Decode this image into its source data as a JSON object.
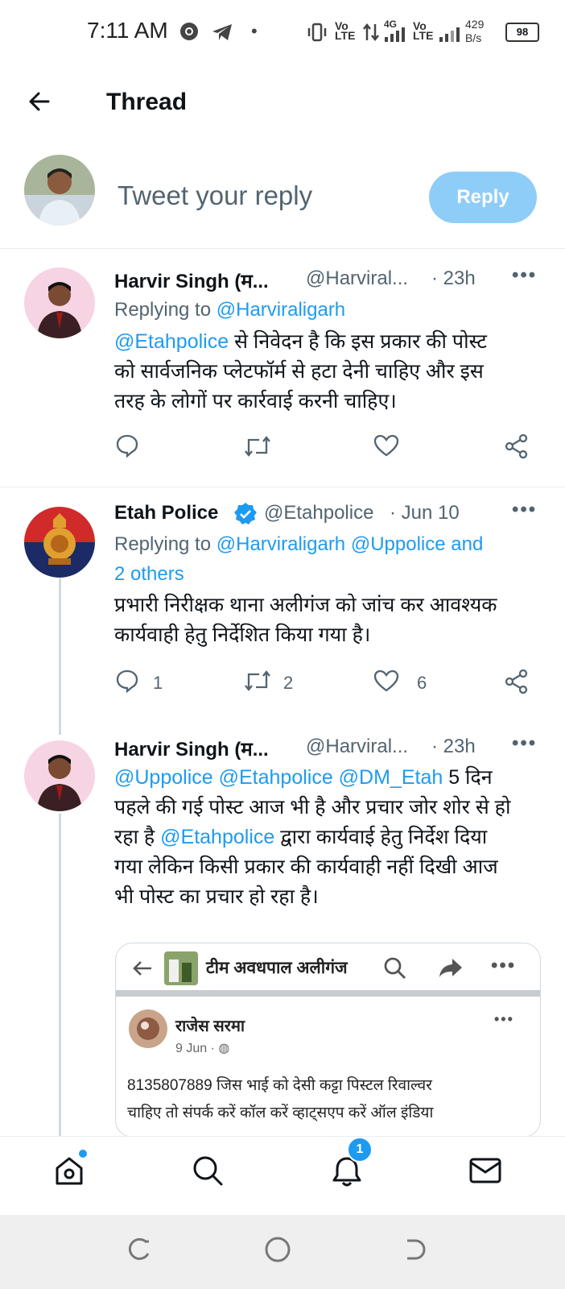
{
  "status_bar": {
    "time": "7:11 AM",
    "net_speed_value": "429",
    "net_speed_unit": "B/s",
    "battery": "98",
    "vo1": "Vo",
    "lte1": "LTE",
    "g4": "4G",
    "vo2": "Vo",
    "lte2": "LTE"
  },
  "header": {
    "title": "Thread"
  },
  "composer": {
    "placeholder": "Tweet your reply",
    "reply_button": "Reply"
  },
  "tweets": [
    {
      "name": "Harvir Singh (म...",
      "handle": "@Harviral...",
      "time": "· 23h",
      "replying_label": "Replying to",
      "replying_to": "@Harviraligarh",
      "body_mention": "@Etahpolice",
      "body_lines": [
        " से निवेदन है कि इस प्रकार की पोस्ट",
        "को सार्वजनिक प्लेटफॉर्म से हटा देनी चाहिए और इस",
        "तरह के लोगों पर कार्रवाई करनी चाहिए।"
      ]
    },
    {
      "name": "Etah Police",
      "handle": "@Etahpolice",
      "time": "· Jun 10",
      "replying_label": "Replying to",
      "replying_to": "@Harviraligarh @Uppolice and",
      "replying_to_2": "2 others",
      "body_lines": [
        "प्रभारी निरीक्षक थाना अलीगंज को जांच कर आवश्यक",
        "कार्यवाही हेतु निर्देशित किया गया है।"
      ],
      "replies": "1",
      "retweets": "2",
      "likes": "6"
    },
    {
      "name": "Harvir Singh (म...",
      "handle": "@Harviral...",
      "time": "· 23h",
      "mentions": "@Uppolice @Etahpolice @DM_Etah",
      "line1_rest": " 5 दिन",
      "line2": "पहले की गई पोस्ट आज भी है और प्रचार जोर शोर से हो",
      "line3_pre": "रहा है ",
      "line3_mention": "@Etahpolice",
      "line3_rest": " द्वारा कार्यवाई हेतु निर्देश दिया",
      "line4": "गया लेकिन किसी प्रकार की कार्यवाही नहीं दिखी आज",
      "line5": "भी पोस्ट का प्रचार हो रहा है।"
    }
  ],
  "embed": {
    "group_name": "टीम अवधपाल अलीगंज",
    "poster": "राजेस सरमा",
    "date": "9 Jun ·",
    "text_line1": "8135807889  जिस भाई को देसी कट्टा पिस्टल रिवाल्वर",
    "text_line2": "चाहिए तो संपर्क करें कॉल करें व्हाट्सएप करें ऑल इंडिया"
  },
  "bottom_nav": {
    "notification_count": "1"
  },
  "colors": {
    "accent": "#1d9bf0",
    "muted": "#536471",
    "reply_btn": "#8ecdf8"
  }
}
